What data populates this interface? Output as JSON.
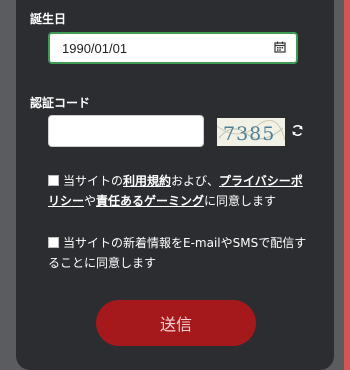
{
  "form": {
    "dob_label": "誕生日",
    "dob_value": "1990/01/01",
    "code_label": "認証コード",
    "code_value": "",
    "captcha_text": "7385"
  },
  "consent1": {
    "p1": "当サイトの",
    "link_terms": "利用規約",
    "p2": "および、",
    "link_privacy": "プライバシーポリシー",
    "p3": "や",
    "link_gaming": "責任あるゲーミング",
    "p4": "に同意します",
    "checked": false
  },
  "consent2": {
    "text": "当サイトの新着情報をE-mailやSMSで配信することに同意します",
    "checked": false
  },
  "submit_label": "送信",
  "colors": {
    "card_bg": "#2b2d31",
    "focus_border": "#3f9a54",
    "submit_bg": "#a5191c"
  },
  "icons": [
    "calendar-icon",
    "refresh-icon"
  ]
}
